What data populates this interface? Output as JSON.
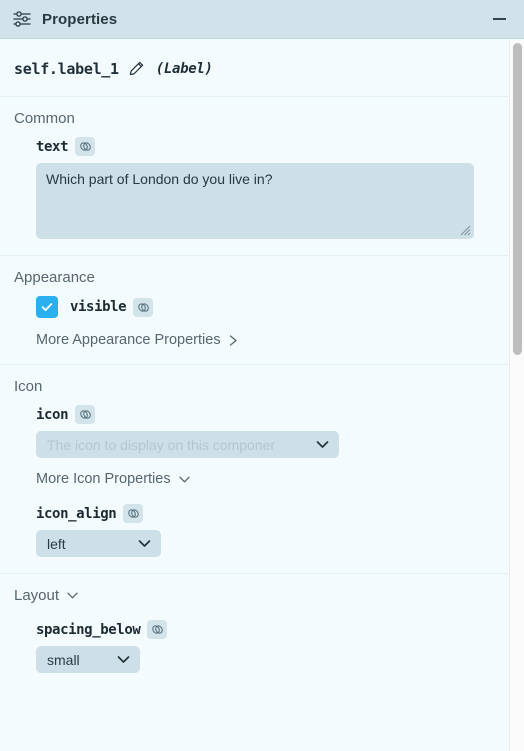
{
  "header": {
    "icon": "sliders-icon",
    "title": "Properties",
    "minimize_label": "—"
  },
  "component": {
    "name": "self.label_1",
    "edit_icon": "pencil-icon",
    "type": "(Label)"
  },
  "sections": [
    {
      "id": "common",
      "title": "Common",
      "properties": [
        {
          "name": "text",
          "link_icon": "link-icon",
          "control": "textarea",
          "value": "Which part of London do you live in?"
        }
      ]
    },
    {
      "id": "appearance",
      "title": "Appearance",
      "properties": [
        {
          "name": "visible",
          "link_icon": "link-icon",
          "control": "checkbox",
          "checked": true
        }
      ],
      "more_link": {
        "label": "More Appearance Properties",
        "chevron": "chevron-right-icon"
      }
    },
    {
      "id": "icon",
      "title": "Icon",
      "properties": [
        {
          "name": "icon",
          "link_icon": "link-icon",
          "control": "dropdown",
          "value": "",
          "placeholder": "The icon to display on this componer"
        },
        {
          "name": "icon_align",
          "link_icon": "link-icon",
          "control": "dropdown",
          "value": "left"
        }
      ],
      "more_link": {
        "label": "More Icon Properties",
        "chevron": "chevron-down-icon"
      }
    },
    {
      "id": "layout",
      "title": "Layout",
      "title_chevron": "chevron-down-icon",
      "properties": [
        {
          "name": "spacing_below",
          "link_icon": "link-icon",
          "control": "dropdown",
          "value": "small"
        }
      ]
    }
  ],
  "colors": {
    "header_bg": "#d2e2ea",
    "panel_bg": "#f4fbfd",
    "field_bg": "#cddfe7",
    "accent": "#29b0f0",
    "text": "#1b2a33",
    "muted": "#56666f",
    "placeholder": "#b5c6cf",
    "divider": "#e2eff3",
    "scrollbar": "#bdbdbd"
  }
}
